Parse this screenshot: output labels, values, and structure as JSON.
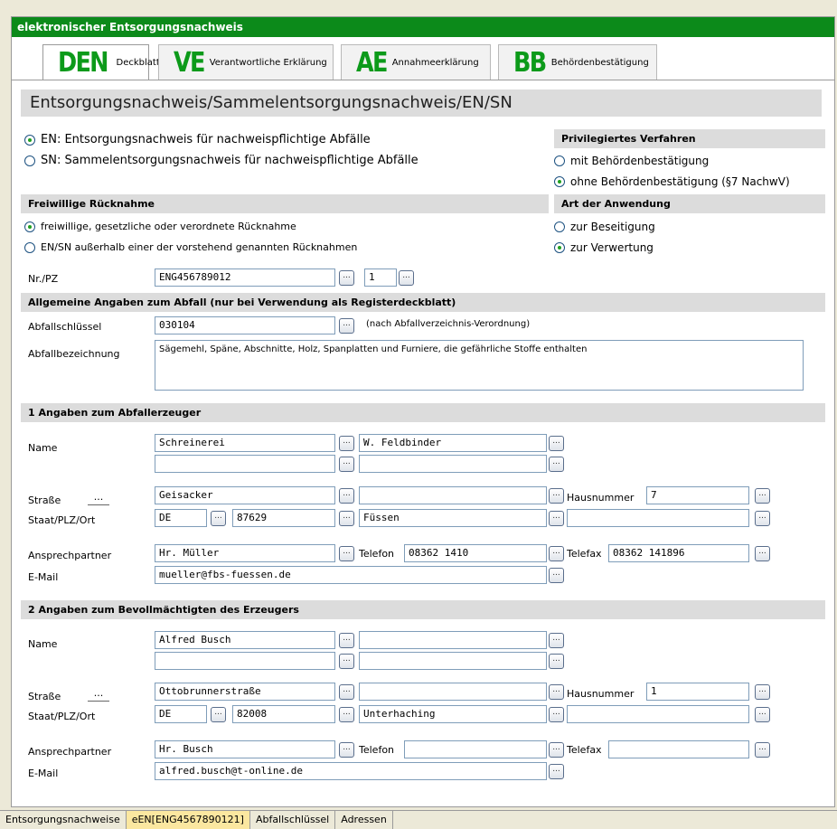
{
  "app_title": "elektronischer Entsorgungsnachweis",
  "tabs": [
    {
      "abbr": "DEN",
      "label": "Deckblatt"
    },
    {
      "abbr": "VE",
      "label": "Verantwortliche Erklärung"
    },
    {
      "abbr": "AE",
      "label": "Annahmeerklärung"
    },
    {
      "abbr": "BB",
      "label": "Behördenbestätigung"
    }
  ],
  "page_title": "Entsorgungsnachweis/Sammelentsorgungsnachweis/EN/SN",
  "nachweis_type": {
    "en": "EN: Entsorgungsnachweis für nachweispflichtige Abfälle",
    "sn": "SN: Sammelentsorgungsnachweis für nachweispflichtige Abfälle",
    "selected": "en"
  },
  "privileged": {
    "heading": "Privilegiertes Verfahren",
    "opt1": "mit Behördenbestätigung",
    "opt2": "ohne Behördenbestätigung (§7 NachwV)",
    "selected": "opt2"
  },
  "ruecknahme": {
    "heading": "Freiwillige Rücknahme",
    "opt1": "freiwillige, gesetzliche oder verordnete Rücknahme",
    "opt2": "EN/SN außerhalb einer der vorstehend genannten Rücknahmen",
    "selected": "opt1"
  },
  "anwendung": {
    "heading": "Art der Anwendung",
    "opt1": "zur Beseitigung",
    "opt2": "zur Verwertung",
    "selected": "opt2"
  },
  "nr": {
    "label": "Nr./PZ",
    "value": "ENG456789012",
    "pz": "1"
  },
  "abfall": {
    "heading": "Allgemeine Angaben zum Abfall (nur bei Verwendung als Registerdeckblatt)",
    "schluessel_label": "Abfallschlüssel",
    "schluessel": "030104",
    "schluessel_note": "(nach Abfallverzeichnis-Verordnung)",
    "bezeichnung_label": "Abfallbezeichnung",
    "bezeichnung": "Sägemehl, Späne, Abschnitte, Holz, Spanplatten und Furniere, die gefährliche Stoffe enthalten"
  },
  "labels": {
    "name": "Name",
    "strasse": "Straße",
    "staat": "Staat/PLZ/Ort",
    "ansprech": "Ansprechpartner",
    "email": "E-Mail",
    "hausnr": "Hausnummer",
    "telefon": "Telefon",
    "telefax": "Telefax",
    "dots": "...",
    "ellipsis": "..."
  },
  "erzeuger": {
    "heading": "1 Angaben zum Abfallerzeuger",
    "name1": "Schreinerei",
    "name2": "W. Feldbinder",
    "name3": "",
    "name4": "",
    "strasse": "Geisacker",
    "strasse2": "",
    "hausnr": "7",
    "staat": "DE",
    "plz": "87629",
    "ort": "Füssen",
    "ort2": "",
    "ansprech": "Hr. Müller",
    "telefon": "08362 1410",
    "telefax": "08362 141896",
    "email": "mueller@fbs-fuessen.de"
  },
  "bevollmaechtigter": {
    "heading": "2 Angaben zum Bevollmächtigten des Erzeugers",
    "name1": "Alfred Busch",
    "name2": "",
    "name3": "",
    "name4": "",
    "strasse": "Ottobrunnerstraße",
    "strasse2": "",
    "hausnr": "1",
    "staat": "DE",
    "plz": "82008",
    "ort": "Unterhaching",
    "ort2": "",
    "ansprech": "Hr. Busch",
    "telefon": "",
    "telefax": "",
    "email": "alfred.busch@t-online.de"
  },
  "bottom_tabs": [
    "Entsorgungsnachweise",
    "eEN[ENG4567890121]",
    "Abfallschlüssel",
    "Adressen"
  ],
  "colors": {
    "title_bar": "#0c8a1a",
    "tab_abbr": "#0c9a1a",
    "heading_bg": "#dcdcdc"
  }
}
